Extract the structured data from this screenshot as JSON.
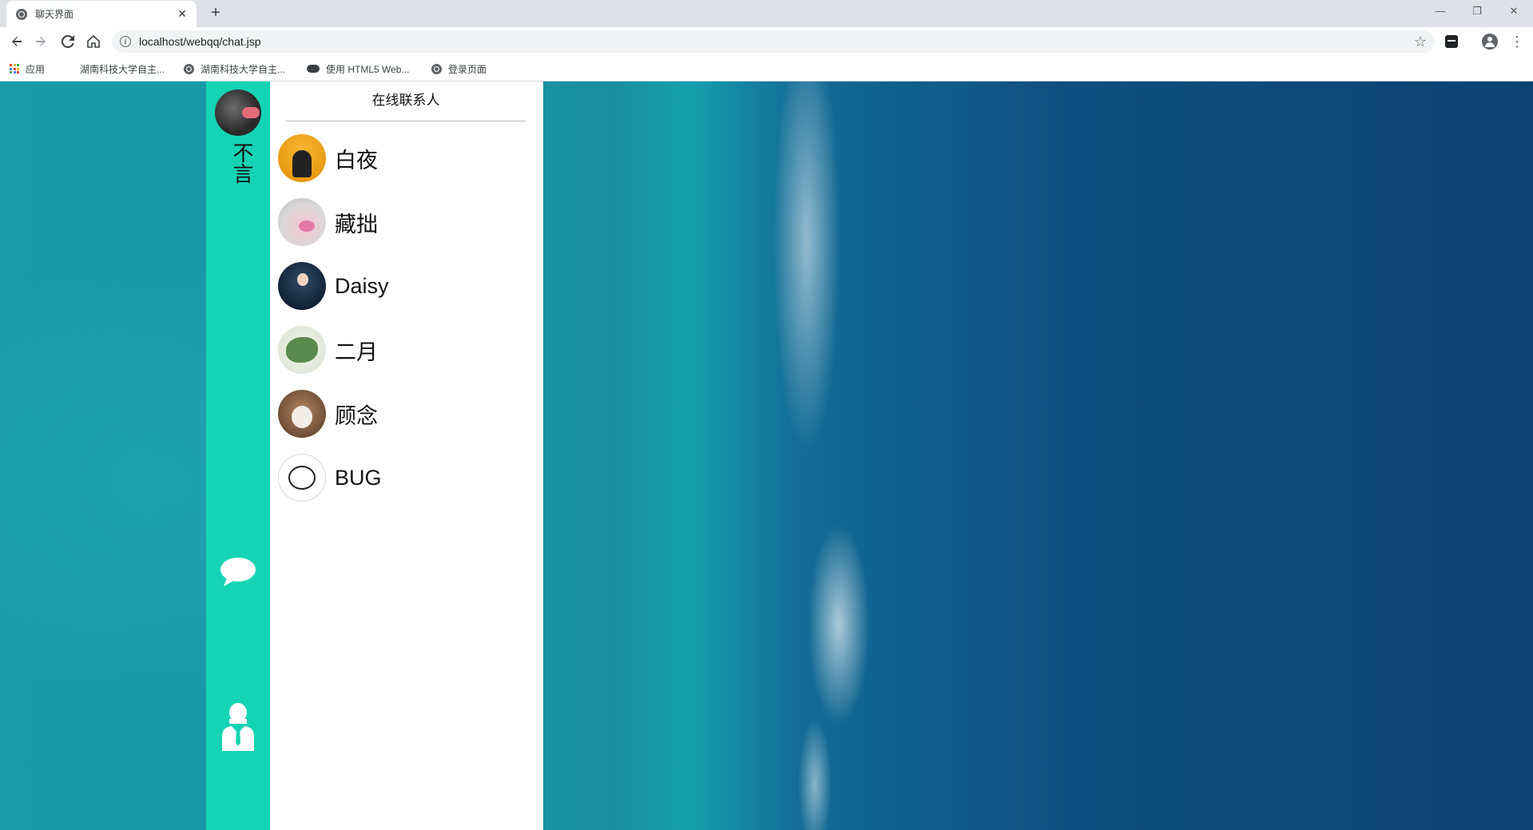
{
  "browser": {
    "tab": {
      "title": "聊天界面",
      "close_glyph": "✕"
    },
    "new_tab_glyph": "+",
    "window_controls": {
      "minimize": "—",
      "maximize": "❐",
      "close": "✕"
    },
    "url": "localhost/webqq/chat.jsp",
    "bookmarks": [
      {
        "label": "应用",
        "icon": "apps-grid-icon"
      },
      {
        "label": "湖南科技大学自主...",
        "icon": "globe-icon"
      },
      {
        "label": "湖南科技大学自主...",
        "icon": "globe-icon"
      },
      {
        "label": "使用 HTML5 Web...",
        "icon": "cloud-icon"
      },
      {
        "label": "登录页面",
        "icon": "globe-icon"
      }
    ]
  },
  "app": {
    "user": {
      "name": "不言",
      "avatar": "user-avatar"
    },
    "sidebar_icons": [
      "chat-bubble-icon",
      "contacts-person-icon"
    ],
    "accent_color": "#15d4b5",
    "contact_panel": {
      "title": "在线联系人",
      "contacts": [
        {
          "name": "白夜"
        },
        {
          "name": "藏拙"
        },
        {
          "name": "Daisy"
        },
        {
          "name": "二月"
        },
        {
          "name": "顾念"
        },
        {
          "name": "BUG"
        }
      ]
    }
  }
}
